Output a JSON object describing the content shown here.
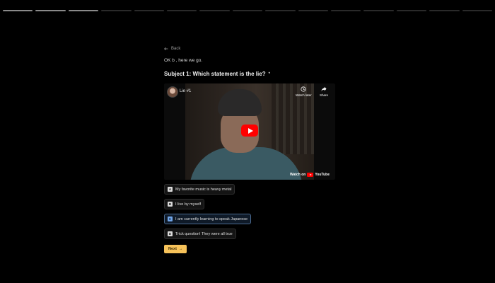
{
  "progress": {
    "total_segments": 15,
    "completed_segments": 3
  },
  "nav": {
    "back_label": "Back"
  },
  "intro": "OK b , here we go.",
  "question": {
    "title": "Subject 1: Which statement is the lie?",
    "required_marker": "*"
  },
  "video": {
    "title": "Lie #1",
    "watch_later_label": "Watch later",
    "share_label": "Share",
    "watch_on_label": "Watch on",
    "brand_label": "YouTube"
  },
  "options": [
    {
      "key": "A",
      "label": "My favorite music is heavy metal",
      "selected": false
    },
    {
      "key": "B",
      "label": "I live by myself",
      "selected": false
    },
    {
      "key": "C",
      "label": "I am currently learning to speak Japanese",
      "selected": true
    },
    {
      "key": "D",
      "label": "Trick question! They were all true",
      "selected": false
    }
  ],
  "next": {
    "label": "Next",
    "arrow": "→"
  },
  "colors": {
    "accent": "#f6c25a",
    "selected_border": "#4a6a90",
    "background": "#000000"
  }
}
